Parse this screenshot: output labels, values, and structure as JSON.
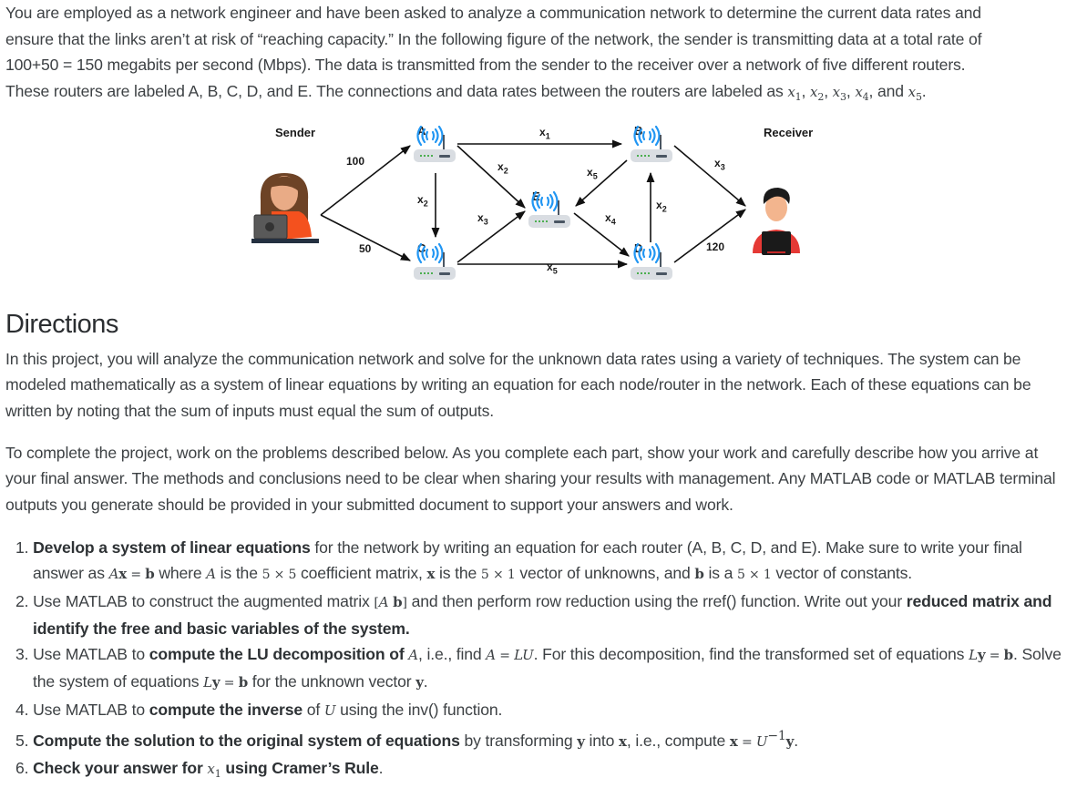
{
  "intro": {
    "line1": "You are employed as a network engineer and have been asked to analyze a communication network to determine the current data rates and",
    "line2": "ensure that the links aren’t at risk of “reaching capacity.” In the following figure of the network, the sender is transmitting data at a total rate of",
    "line3": "100+50 = 150 megabits per second (Mbps). The data is transmitted from the sender to the receiver over a network of five different routers.",
    "line4_pre": "These routers are labeled A, B, C, D, and E. The connections and data rates between the routers are labeled as ",
    "vars": [
      "x1",
      "x2",
      "x3",
      "x4",
      "x5"
    ],
    "line4_and": ", and ",
    "line4_end": "."
  },
  "figure": {
    "sender_label": "Sender",
    "receiver_label": "Receiver",
    "routers": [
      "A",
      "B",
      "C",
      "D",
      "E"
    ],
    "edges": [
      {
        "from": "Sender",
        "to": "A",
        "label": "100"
      },
      {
        "from": "Sender",
        "to": "C",
        "label": "50"
      },
      {
        "from": "A",
        "to": "B",
        "label": "x1"
      },
      {
        "from": "A",
        "to": "C",
        "label": "x2"
      },
      {
        "from": "A",
        "to": "E",
        "label": "x2"
      },
      {
        "from": "C",
        "to": "E",
        "label": "x3"
      },
      {
        "from": "C",
        "to": "D",
        "label": "x5"
      },
      {
        "from": "B",
        "to": "E",
        "label": "x5"
      },
      {
        "from": "E",
        "to": "D",
        "label": "x4"
      },
      {
        "from": "D",
        "to": "B",
        "label": "x2"
      },
      {
        "from": "B",
        "to": "Receiver",
        "label": "x3"
      },
      {
        "from": "D",
        "to": "Receiver",
        "label": "120"
      }
    ],
    "colors": {
      "wifi": "#2196f3",
      "router_body": "#d9dde2",
      "led": "#4caf50",
      "sender_shirt": "#f4511e",
      "receiver_shirt": "#e53935"
    }
  },
  "directions": {
    "title": "Directions",
    "para1": "In this project, you will analyze the communication network and solve for the unknown data rates using a variety of techniques. The system can be modeled mathematically as a system of linear equations by writing an equation for each node/router in the network. Each of these equations can be written by noting that the sum of inputs must equal the sum of outputs.",
    "para2": "To complete the project, work on the problems described below. As you complete each part, show your work and carefully describe how you arrive at your final answer. The methods and conclusions need to be clear when sharing your results with management. Any MATLAB code or MATLAB terminal outputs you generate should be provided in your submitted document to support your answers and work."
  },
  "tasks": [
    {
      "num": "1. ",
      "bold": "Develop a system of linear equations",
      "rest": " for the network by writing an equation for each router (A, B, C, D, and E). Make sure to write your final answer as ",
      "tail": " where A is the 5 × 5 coefficient matrix, x is the 5 × 1 vector of unknowns, and b is a 5 × 1 vector of constants."
    },
    {
      "num": "2. ",
      "text": "Use MATLAB to construct the augmented matrix [A b] and then perform row reduction using the rref() function. Write out your ",
      "bold": "reduced matrix and identify the free and basic variables of the system."
    },
    {
      "num": "3.  ",
      "pre": "Use MATLAB to ",
      "bold": "compute the LU decomposition of",
      "rest": " A, i.e., find A = LU. For this decomposition, find the transformed set of equations Ly = b. Solve the system of equations Ly = b for the unknown vector y."
    },
    {
      "num": "4. ",
      "pre": "Use MATLAB to ",
      "bold": "compute the inverse",
      "rest": " of U using the inv() function."
    },
    {
      "num": "5. ",
      "bold": "Compute the solution to the original system of equations",
      "rest": " by transforming y into x, i.e., compute x = U⁻¹y."
    },
    {
      "num": "6. ",
      "bold": "Check your answer for",
      "mid": " x1 ",
      "bold2": "using Cramer’s Rule",
      "end": "."
    }
  ]
}
